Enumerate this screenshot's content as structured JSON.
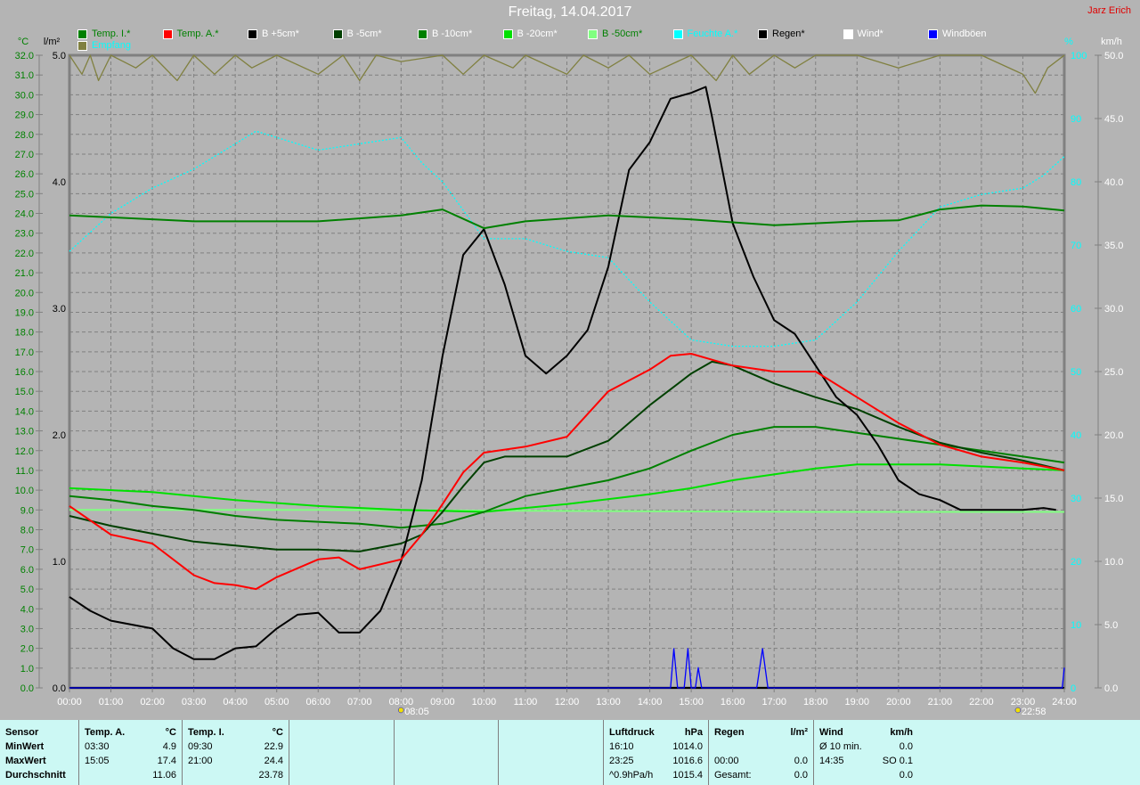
{
  "header": {
    "title": "Freitag, 14.04.2017",
    "author": "Jarz Erich"
  },
  "legend": [
    {
      "label": "Temp. I.*",
      "color": "#008000",
      "text_color": "#008000"
    },
    {
      "label": "Temp. A.*",
      "color": "#ff0000",
      "text_color": "#008000"
    },
    {
      "label": "B +5cm*",
      "color": "#000000",
      "text_color": "#ffffff"
    },
    {
      "label": "B -5cm*",
      "color": "#004000",
      "text_color": "#ffffff"
    },
    {
      "label": "B -10cm*",
      "color": "#008000",
      "text_color": "#ffffff"
    },
    {
      "label": "B -20cm*",
      "color": "#00e000",
      "text_color": "#ffffff"
    },
    {
      "label": "B -50cm*",
      "color": "#80ff80",
      "text_color": "#008000"
    },
    {
      "label": "Feuchte A.*",
      "color": "#00ffff",
      "text_color": "#00ffff"
    },
    {
      "label": "Regen*",
      "color": "#000000",
      "text_color": "#000000"
    },
    {
      "label": "Wind*",
      "color": "#ffffff",
      "text_color": "#ffffff"
    },
    {
      "label": "Windböen",
      "color": "#0000ff",
      "text_color": "#ffffff"
    },
    {
      "label": "Empfang",
      "color": "#808040",
      "text_color": "#00ffff"
    }
  ],
  "chart_data": {
    "type": "line",
    "title": "Freitag, 14.04.2017",
    "x_ticks": [
      "00:00",
      "01:00",
      "02:00",
      "03:00",
      "04:00",
      "05:00",
      "06:00",
      "07:00",
      "08:00",
      "09:00",
      "10:00",
      "11:00",
      "12:00",
      "13:00",
      "14:00",
      "15:00",
      "16:00",
      "17:00",
      "18:00",
      "19:00",
      "20:00",
      "21:00",
      "22:00",
      "23:00",
      "24:00"
    ],
    "xlim": [
      0,
      24
    ],
    "axes": {
      "temp": {
        "unit": "°C",
        "ylim": [
          0,
          32
        ],
        "step": 1
      },
      "rain": {
        "unit": "l/m²",
        "ylim": [
          0,
          5
        ],
        "step": 1
      },
      "humidity": {
        "unit": "%",
        "ylim": [
          0,
          100
        ],
        "step": 10
      },
      "wind": {
        "unit": "km/h",
        "ylim": [
          0,
          50
        ],
        "step": 5
      }
    },
    "markers": [
      {
        "label": "08:05",
        "icon": "sunrise"
      },
      {
        "label": "22:58",
        "icon": "sunset"
      }
    ],
    "series": [
      {
        "name": "Temp. I.",
        "axis": "temp",
        "color": "#008000",
        "x": [
          0,
          3,
          6,
          8,
          9,
          10,
          11,
          13,
          15,
          17,
          19,
          20,
          21,
          22,
          23,
          24
        ],
        "y": [
          23.9,
          23.6,
          23.6,
          23.9,
          24.2,
          23.25,
          23.6,
          23.9,
          23.7,
          23.4,
          23.6,
          23.65,
          24.2,
          24.4,
          24.35,
          24.15
        ]
      },
      {
        "name": "Temp. A.",
        "axis": "temp",
        "color": "#ff0000",
        "x": [
          0,
          1,
          2,
          3,
          3.5,
          4,
          4.5,
          5,
          6,
          6.5,
          7,
          8,
          8.5,
          9,
          9.5,
          10,
          11,
          12,
          13,
          14,
          14.5,
          15,
          15.5,
          16,
          17,
          18,
          19,
          20,
          21,
          22,
          23,
          24
        ],
        "y": [
          9.2,
          7.75,
          7.3,
          5.7,
          5.3,
          5.2,
          5.0,
          5.6,
          6.5,
          6.6,
          6.0,
          6.5,
          7.75,
          9.3,
          10.9,
          11.9,
          12.2,
          12.7,
          15.0,
          16.1,
          16.8,
          16.9,
          16.6,
          16.3,
          16.0,
          16.0,
          14.7,
          13.4,
          12.3,
          11.7,
          11.4,
          11.0
        ]
      },
      {
        "name": "B +5cm",
        "axis": "temp",
        "color": "#000000",
        "x": [
          0,
          0.5,
          1,
          2,
          2.5,
          3,
          3.5,
          4,
          4.5,
          5,
          5.5,
          6,
          6.5,
          7,
          7.5,
          8,
          8.5,
          9,
          9.5,
          10,
          10.5,
          11,
          11.5,
          12,
          12.5,
          13,
          13.5,
          14,
          14.5,
          15,
          15.35,
          15.5,
          16,
          16.5,
          17,
          17.5,
          18,
          18.5,
          19,
          19.5,
          20,
          20.5,
          21,
          21.5,
          22,
          23,
          23.5,
          23.8
        ],
        "y": [
          4.6,
          3.9,
          3.4,
          3.0,
          2.0,
          1.45,
          1.45,
          2.0,
          2.1,
          3.0,
          3.7,
          3.8,
          2.8,
          2.8,
          3.9,
          6.4,
          10.5,
          16.8,
          21.9,
          23.2,
          20.4,
          16.8,
          15.9,
          16.8,
          18.1,
          21.3,
          26.2,
          27.6,
          29.8,
          30.1,
          30.4,
          28.9,
          23.5,
          20.8,
          18.6,
          17.9,
          16.3,
          14.7,
          13.8,
          12.3,
          10.5,
          9.8,
          9.5,
          9.0,
          9.0,
          9.0,
          9.1,
          9.0
        ]
      },
      {
        "name": "B -5cm",
        "axis": "temp",
        "color": "#004000",
        "x": [
          0,
          1,
          2,
          3,
          4,
          5,
          6,
          7,
          8,
          8.5,
          9,
          9.5,
          10,
          10.5,
          11,
          12,
          13,
          14,
          15,
          15.5,
          16,
          17,
          18,
          19,
          20,
          21,
          22,
          23,
          24
        ],
        "y": [
          8.7,
          8.2,
          7.8,
          7.4,
          7.2,
          7.0,
          7.0,
          6.9,
          7.3,
          7.75,
          8.9,
          10.2,
          11.4,
          11.7,
          11.7,
          11.7,
          12.5,
          14.3,
          15.9,
          16.5,
          16.3,
          15.4,
          14.7,
          14.1,
          13.2,
          12.4,
          11.9,
          11.5,
          11.0
        ]
      },
      {
        "name": "B -10cm",
        "axis": "temp",
        "color": "#008000",
        "x": [
          0,
          1,
          2,
          3,
          4,
          5,
          6,
          7,
          8,
          9,
          10,
          11,
          12,
          13,
          14,
          15,
          16,
          17,
          18,
          19,
          20,
          21,
          22,
          23,
          24
        ],
        "y": [
          9.7,
          9.5,
          9.2,
          9.0,
          8.7,
          8.5,
          8.4,
          8.3,
          8.1,
          8.3,
          8.9,
          9.7,
          10.1,
          10.5,
          11.1,
          12.0,
          12.8,
          13.2,
          13.2,
          12.9,
          12.6,
          12.3,
          12.0,
          11.7,
          11.4
        ]
      },
      {
        "name": "B -20cm",
        "axis": "temp",
        "color": "#00e000",
        "x": [
          0,
          2,
          4,
          6,
          8,
          10,
          12,
          14,
          15,
          16,
          17,
          18,
          19,
          20,
          21,
          22,
          23,
          24
        ],
        "y": [
          10.1,
          9.9,
          9.5,
          9.2,
          9.0,
          8.9,
          9.3,
          9.8,
          10.1,
          10.5,
          10.8,
          11.1,
          11.3,
          11.3,
          11.3,
          11.2,
          11.1,
          11.0
        ]
      },
      {
        "name": "B -50cm",
        "axis": "temp",
        "color": "#80ff80",
        "x": [
          0,
          6,
          12,
          18,
          24
        ],
        "y": [
          9.0,
          9.0,
          8.95,
          8.9,
          8.9
        ]
      },
      {
        "name": "Feuchte A.",
        "axis": "humidity",
        "color": "#00ffff",
        "dashed": true,
        "x": [
          0,
          1,
          2,
          3,
          4,
          4.5,
          5,
          6,
          7,
          8,
          8.5,
          9,
          10,
          11,
          12,
          13,
          14,
          15,
          16,
          17,
          18,
          19,
          20,
          21,
          22,
          23,
          23.5,
          24
        ],
        "y": [
          69,
          75,
          79,
          82,
          86,
          88,
          87,
          85,
          86,
          87,
          83,
          80,
          71,
          71,
          69,
          68,
          61,
          55,
          54,
          54,
          55,
          61,
          69,
          76,
          78,
          79,
          81,
          84
        ]
      },
      {
        "name": "Windböen",
        "axis": "wind",
        "color": "#0000ff",
        "x": [
          0,
          14.5,
          14.58,
          14.67,
          14.83,
          14.92,
          15.0,
          15.1,
          15.17,
          15.25,
          16.58,
          16.72,
          16.85,
          23.95,
          24
        ],
        "y": [
          0,
          0,
          3.1,
          0,
          0,
          3.1,
          0,
          0,
          1.6,
          0,
          0,
          3.1,
          0,
          0,
          1.6
        ]
      },
      {
        "name": "Empfang",
        "axis": "humidity",
        "color": "#808040",
        "x": [
          0,
          0.3,
          0.5,
          0.7,
          1,
          1.6,
          2,
          2.6,
          3,
          3.5,
          4,
          4.4,
          5,
          6,
          6.6,
          7,
          7.4,
          8,
          9,
          9.5,
          10,
          10.7,
          11,
          12,
          12.4,
          13,
          13.5,
          14,
          15,
          15.6,
          16,
          16.4,
          17,
          17.5,
          18,
          19,
          20,
          21,
          22,
          23,
          23.3,
          23.6,
          24
        ],
        "y": [
          100,
          97,
          100,
          96,
          100,
          98,
          100,
          96,
          100,
          97,
          100,
          98,
          100,
          97,
          100,
          96,
          100,
          99,
          100,
          97,
          100,
          98,
          100,
          97,
          100,
          98,
          100,
          97,
          100,
          96,
          100,
          97,
          100,
          98,
          100,
          100,
          98,
          100,
          100,
          97,
          94,
          98,
          100
        ]
      }
    ]
  },
  "panel": {
    "sensor": [
      "Sensor",
      "MinWert",
      "MaxWert",
      "Durchschnitt"
    ],
    "temp_a": {
      "title": "Temp. A.",
      "unit": "°C",
      "rows": [
        [
          "03:30",
          "4.9"
        ],
        [
          "15:05",
          "17.4"
        ],
        [
          "",
          "11.06"
        ]
      ]
    },
    "temp_i": {
      "title": "Temp. I.",
      "unit": "°C",
      "rows": [
        [
          "09:30",
          "22.9"
        ],
        [
          "21:00",
          "24.4"
        ],
        [
          "",
          "23.78"
        ]
      ]
    },
    "luftdruck": {
      "title": "Luftdruck",
      "unit": "hPa",
      "rows": [
        [
          "16:10",
          "1014.0"
        ],
        [
          "23:25",
          "1016.6"
        ],
        [
          "^0.9hPa/h",
          "1015.4"
        ]
      ]
    },
    "regen": {
      "title": "Regen",
      "unit": "l/m²",
      "rows": [
        [
          "",
          ""
        ],
        [
          "00:00",
          "0.0"
        ],
        [
          "Gesamt:",
          "0.0"
        ]
      ]
    },
    "wind": {
      "title": "Wind",
      "unit": "km/h",
      "rows": [
        [
          "Ø 10 min.",
          "0.0"
        ],
        [
          "14:35",
          "SO 0.1"
        ],
        [
          "",
          "0.0"
        ]
      ]
    }
  }
}
